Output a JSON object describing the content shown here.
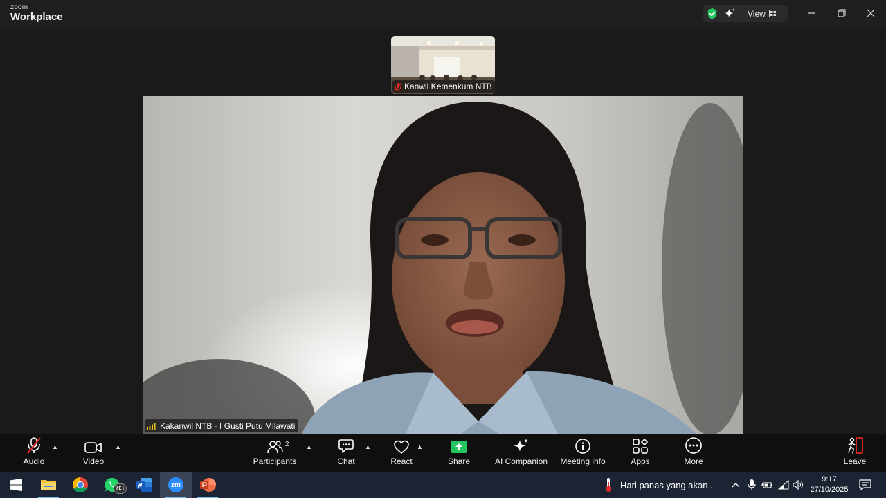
{
  "app": {
    "brand_small": "zoom",
    "brand_large": "Workplace",
    "view_label": "View"
  },
  "thumbnail": {
    "participant_name": "Kanwil Kemenkum NTB"
  },
  "main_video": {
    "speaker_name": "Kakanwil NTB - I Gusti Putu Milawati"
  },
  "toolbar": {
    "audio": "Audio",
    "video": "Video",
    "participants": "Participants",
    "participants_count": "2",
    "chat": "Chat",
    "react": "React",
    "share": "Share",
    "ai_companion": "AI Companion",
    "meeting_info": "Meeting info",
    "apps": "Apps",
    "more": "More",
    "leave": "Leave"
  },
  "taskbar": {
    "whatsapp_badge": "83",
    "zoom_label": "zm",
    "weather_text": "Hari panas yang akan...",
    "time": "9:17",
    "date": "27/10/2025"
  },
  "colors": {
    "share_green": "#22c55e",
    "leave_red": "#e02828",
    "security_green": "#22c55e",
    "taskbar_bg": "#1c2433",
    "toolbar_bg": "#0f0f0f"
  },
  "icons": [
    "zoom-logo",
    "security-shield-icon",
    "ai-sparkle-icon",
    "view-grid-icon",
    "minimize-icon",
    "restore-icon",
    "close-icon",
    "mic-muted-icon",
    "video-camera-icon",
    "participants-icon",
    "chat-icon",
    "react-heart-icon",
    "share-arrow-icon",
    "ai-companion-icon",
    "info-icon",
    "apps-icon",
    "more-dots-icon",
    "leave-icon",
    "windows-start-icon",
    "file-explorer-icon",
    "chrome-icon",
    "whatsapp-icon",
    "word-icon",
    "zoom-taskbar-icon",
    "powerpoint-icon",
    "thermometer-icon",
    "chevron-up-icon",
    "microphone-icon",
    "battery-icon",
    "wifi-icon",
    "speaker-icon",
    "notifications-icon"
  ]
}
